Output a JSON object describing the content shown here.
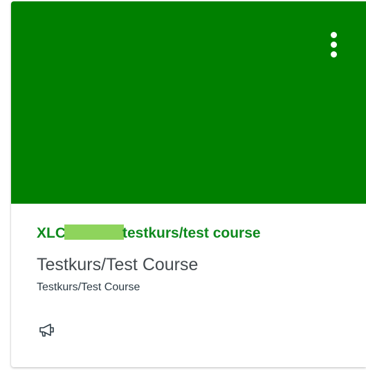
{
  "card": {
    "hero_color": "#008000",
    "course_code_prefix": "XLC",
    "course_code_suffix": "testkurs/test course",
    "title": "Testkurs/Test Course",
    "term": "Testkurs/Test Course",
    "options_icon": "kebab-vertical-icon",
    "announcements_icon": "megaphone-icon"
  }
}
